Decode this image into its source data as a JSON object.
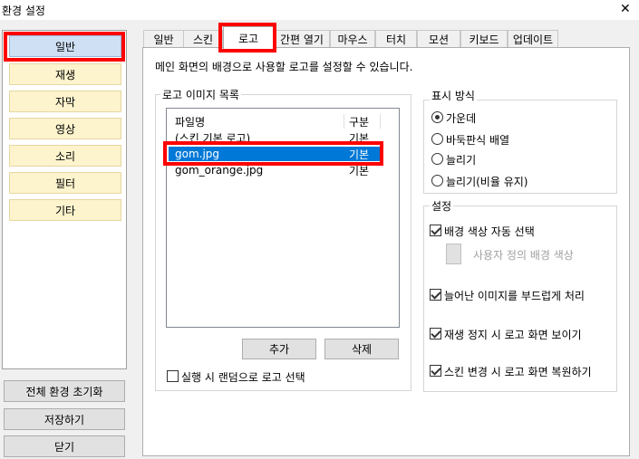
{
  "window": {
    "title": "환경 설정",
    "close_glyph": "✕"
  },
  "sidebar": {
    "items": [
      {
        "label": "일반"
      },
      {
        "label": "재생"
      },
      {
        "label": "자막"
      },
      {
        "label": "영상"
      },
      {
        "label": "소리"
      },
      {
        "label": "필터"
      },
      {
        "label": "기타"
      }
    ],
    "selected_index": 0
  },
  "bottom_buttons": {
    "reset": "전체 환경 초기화",
    "save": "저장하기",
    "close": "닫기"
  },
  "tabs": [
    {
      "label": "일반"
    },
    {
      "label": "스킨"
    },
    {
      "label": "로고"
    },
    {
      "label": "간편 열기"
    },
    {
      "label": "마우스"
    },
    {
      "label": "터치"
    },
    {
      "label": "모션"
    },
    {
      "label": "키보드"
    },
    {
      "label": "업데이트"
    }
  ],
  "active_tab": "로고",
  "logo": {
    "description": "메인 화면의 배경으로 사용할 로고를 설정할 수 있습니다.",
    "list_group_label": "로고 이미지 목록",
    "columns": {
      "name": "파일명",
      "type": "구분"
    },
    "rows": [
      {
        "name": "(스킨 기본 로고)",
        "type": "기본"
      },
      {
        "name": "gom.jpg",
        "type": "기본"
      },
      {
        "name": "gom_orange.jpg",
        "type": "기본"
      }
    ],
    "selected_row": 1,
    "add_button": "추가",
    "delete_button": "삭제",
    "random_on_start": {
      "label": "실행 시 랜덤으로 로고 선택",
      "checked": false
    }
  },
  "display_mode": {
    "group_label": "표시 방식",
    "options": [
      {
        "label": "가운데",
        "checked": true
      },
      {
        "label": "바둑판식 배열",
        "checked": false
      },
      {
        "label": "늘리기",
        "checked": false
      },
      {
        "label": "늘리기(비율 유지)",
        "checked": false
      }
    ]
  },
  "settings": {
    "group_label": "설정",
    "auto_bg_color": {
      "label": "배경 색상 자동 선택",
      "checked": true
    },
    "custom_bg_color": {
      "label": "사용자 정의 배경 색상"
    },
    "smooth_stretched": {
      "label": "늘어난 이미지를 부드럽게 처리",
      "checked": true
    },
    "show_logo_on_stop": {
      "label": "재생 정지 시 로고 화면 보이기",
      "checked": true
    },
    "restore_on_skin_change": {
      "label": "스킨 변경 시 로고 화면 복원하기",
      "checked": true
    }
  },
  "colors": {
    "highlight": "#ff0000",
    "selection": "#0078d7",
    "sidebar_item": "#fdf3cd",
    "sidebar_active": "#cfe0f4"
  }
}
